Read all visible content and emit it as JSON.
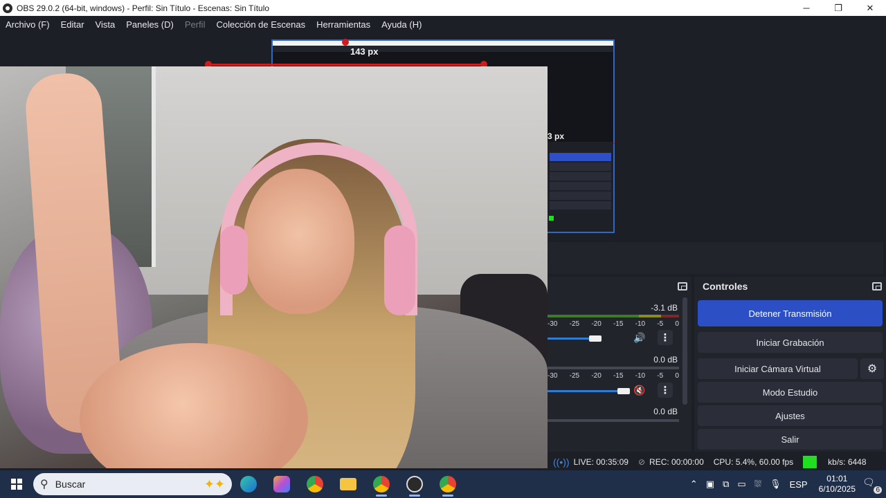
{
  "window": {
    "title": "OBS 29.0.2 (64-bit, windows) - Perfil: Sin Título - Escenas: Sin Título"
  },
  "menu": [
    "Archivo (F)",
    "Editar",
    "Vista",
    "Paneles (D)",
    "Perfil",
    "Colección de Escenas",
    "Herramientas",
    "Ayuda (H)"
  ],
  "preview": {
    "px_label": "143 px",
    "mini_px_label": "3 px"
  },
  "mixer": {
    "tracks": [
      {
        "db": "-3.1 dB",
        "ticks": [
          "-30",
          "-25",
          "-20",
          "-15",
          "-10",
          "-5",
          "0"
        ],
        "muted": false
      },
      {
        "db": "0.0 dB",
        "ticks": [
          "-30",
          "-25",
          "-20",
          "-15",
          "-10",
          "-5",
          "0"
        ],
        "muted": true
      },
      {
        "db": "0.0 dB"
      }
    ],
    "menu_glyph": "⋮"
  },
  "controls": {
    "title": "Controles",
    "stop_stream": "Detener Transmisión",
    "start_recording": "Iniciar Grabación",
    "start_virtual_cam": "Iniciar Cámara Virtual",
    "studio_mode": "Modo Estudio",
    "settings": "Ajustes",
    "exit": "Salir"
  },
  "status": {
    "live": "LIVE: 00:35:09",
    "rec": "REC: 00:00:00",
    "cpu": "CPU: 5.4%, 60.00 fps",
    "kbs": "kb/s: 6448"
  },
  "taskbar": {
    "search_placeholder": "Buscar",
    "language": "ESP",
    "time": "01:01",
    "date": "6/10/2025",
    "notifications": "6"
  },
  "colors": {
    "accent": "#2d4fc6",
    "live_indicator": "#1fe01f",
    "panel_bg": "#22242c"
  }
}
